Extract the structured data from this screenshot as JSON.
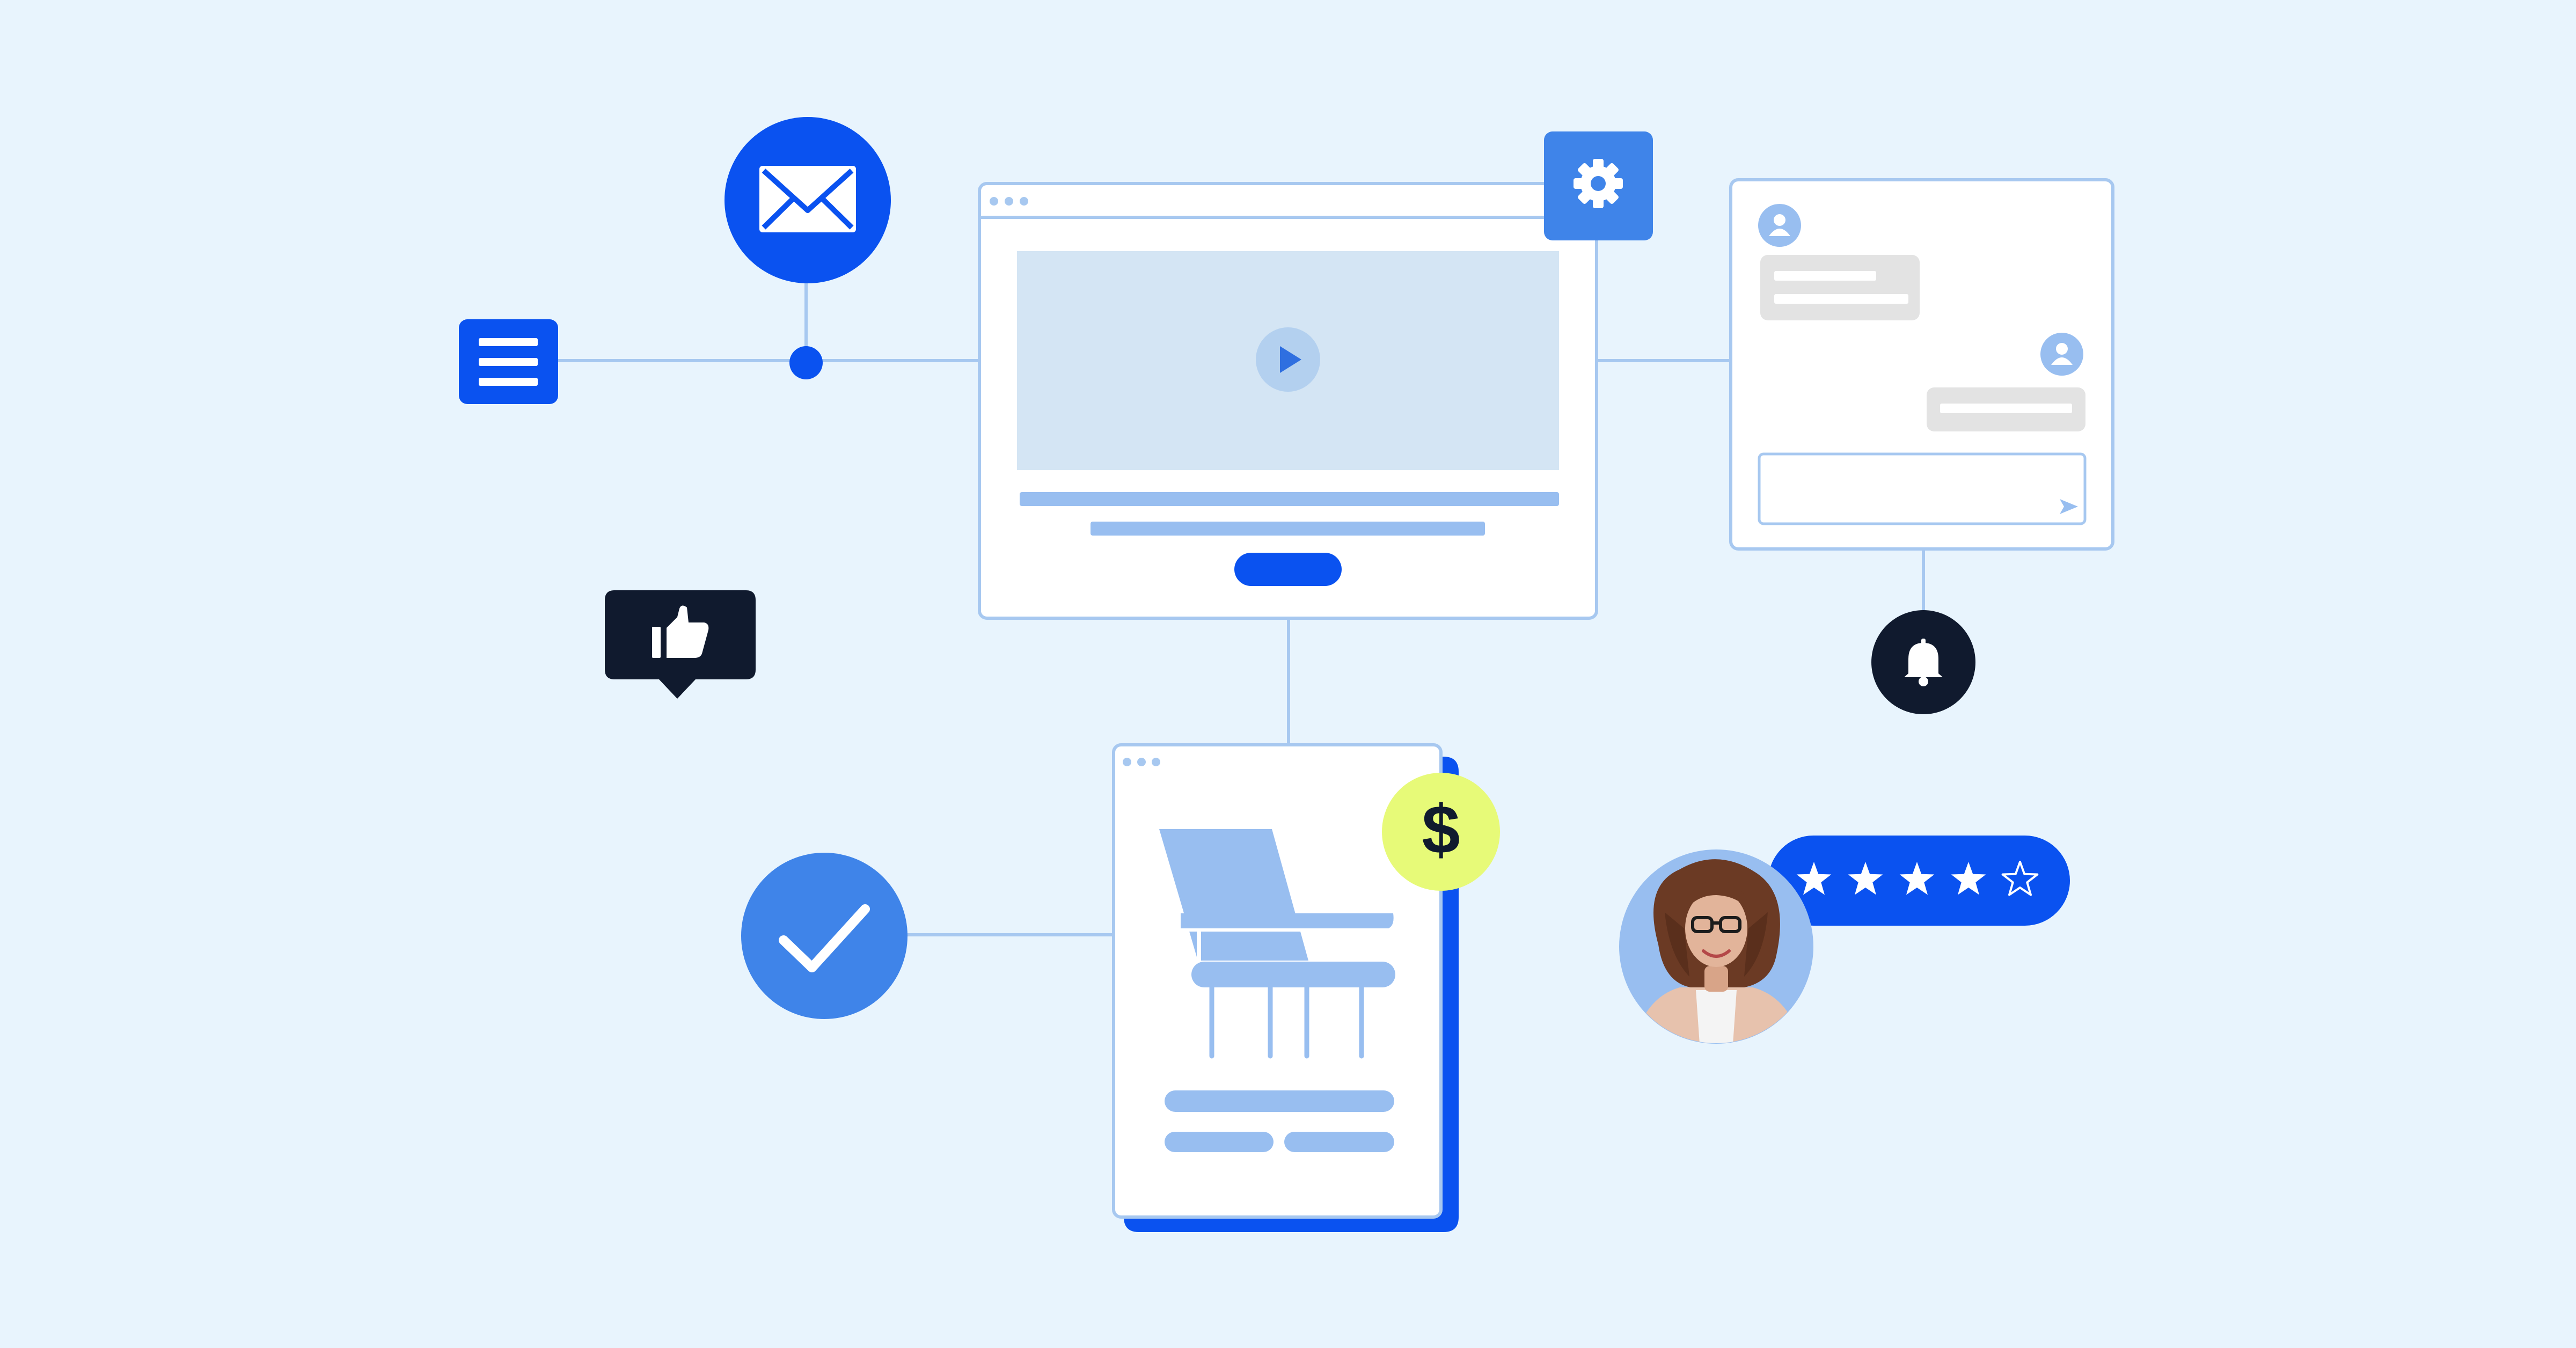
{
  "colors": {
    "background": "#e8f4fd",
    "brand_blue": "#0a52f0",
    "medium_blue": "#3f84e9",
    "light_blue": "#98bef0",
    "outline_blue": "#a7c8f0",
    "video_area": "#d4e5f4",
    "navy": "#101a2e",
    "chat_gray": "#e3e3e3",
    "price_badge": "#e7fa78",
    "white": "#ffffff"
  },
  "icons": {
    "menu": "hamburger-menu-icon",
    "email": "envelope-icon",
    "settings": "gear-icon",
    "play": "play-icon",
    "like": "thumbs-up-icon",
    "notification": "bell-icon",
    "approve": "checkmark-icon",
    "product": "chair-icon",
    "chat_avatar": "user-icon",
    "send": "send-icon",
    "reviewer": "person-portrait"
  },
  "price_badge": {
    "symbol": "$"
  },
  "review": {
    "rating": 4,
    "max_rating": 5
  }
}
